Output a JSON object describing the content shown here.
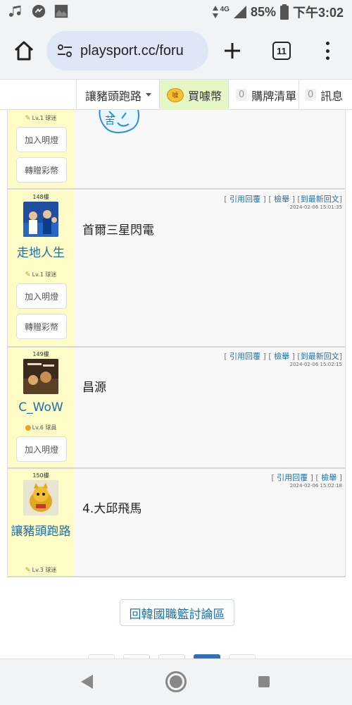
{
  "status_bar": {
    "network": "4G",
    "battery": "85%",
    "time": "下午3:02"
  },
  "browser": {
    "url": "playsport.cc/foru",
    "tab_count": "11"
  },
  "site_nav": {
    "user": "讓豬頭跑路",
    "buy_coins": "買噱幣",
    "coin_badge": "噱",
    "cart_count": "0",
    "cart_label": "購牌清單",
    "msg_count": "0",
    "msg_label": "訊息"
  },
  "posts": [
    {
      "level": "Lv.1 球迷",
      "buttons": [
        "加入明燈",
        "轉贈彩幣"
      ]
    },
    {
      "floor": "148樓",
      "username": "走地人生",
      "level": "Lv.1 球迷",
      "actions": [
        "引用回覆",
        "檢舉",
        "到最新回文"
      ],
      "timestamp": "2024-02-06 15:01:35",
      "text": "首爾三星閃電",
      "buttons": [
        "加入明燈",
        "轉贈彩幣"
      ]
    },
    {
      "floor": "149樓",
      "username": "C_WoW",
      "level": "Lv.6 球員",
      "actions": [
        "引用回覆",
        "檢舉",
        "到最新回文"
      ],
      "timestamp": "2024-02-06 15:02:15",
      "text": "昌源",
      "buttons": [
        "加入明燈"
      ]
    },
    {
      "floor": "150樓",
      "username": "讓豬頭跑路",
      "level": "Lv.3 球迷",
      "actions": [
        "引用回覆",
        "檢舉"
      ],
      "timestamp": "2024-02-06 15:02:18",
      "text": "4.大邱飛馬"
    }
  ],
  "back_button": "回韓國職籃討論區",
  "colors": {
    "link": "#1f6fa6",
    "sidebar": "#fdfbc6",
    "buy_highlight": "#e5f7c4",
    "url_pill": "#dfe6f6"
  }
}
